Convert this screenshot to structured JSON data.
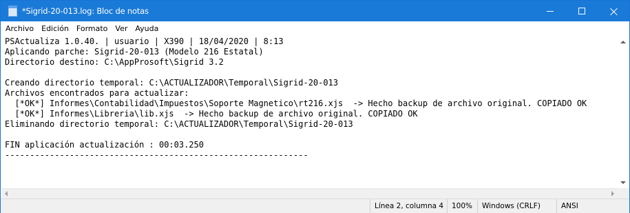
{
  "window": {
    "title": "*Sigrid-20-013.log: Bloc de notas"
  },
  "menu": [
    "Archivo",
    "Edición",
    "Formato",
    "Ver",
    "Ayuda"
  ],
  "content": {
    "lines": [
      "PSActualiza 1.0.40. | usuario | X390 | 18/04/2020 | 8:13",
      "Aplicando parche: Sigrid-20-013 (Modelo 216 Estatal)",
      "Directorio destino: C:\\AppProsoft\\Sigrid 3.2",
      "",
      "Creando directorio temporal: C:\\ACTUALIZADOR\\Temporal\\Sigrid-20-013",
      "Archivos encontrados para actualizar:",
      "  [*OK*] Informes\\Contabilidad\\Impuestos\\Soporte Magnetico\\rt216.xjs  -> Hecho backup de archivo original. COPIADO OK",
      "  [*OK*] Informes\\Libreria\\lib.xjs  -> Hecho backup de archivo original. COPIADO OK",
      "Eliminando directorio temporal: C:\\ACTUALIZADOR\\Temporal\\Sigrid-20-013",
      "",
      "FIN aplicación actualización : 00:03.250",
      "-------------------------------------------------------------",
      "",
      ""
    ]
  },
  "status": {
    "position": "Línea 2, columna 4",
    "zoom": "100%",
    "line_ending": "Windows (CRLF)",
    "encoding": "ANSI"
  },
  "icons": {
    "app": "notepad-icon",
    "minimize": "minimize-icon",
    "maximize": "maximize-icon",
    "close": "close-icon"
  },
  "colors": {
    "titlebar": "#1a7ad8",
    "statusbar": "#f0f0f0"
  }
}
